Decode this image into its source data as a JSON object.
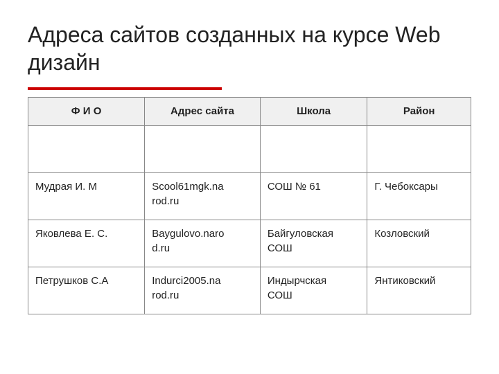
{
  "title": "Адреса сайтов созданных на курсе Web дизайн",
  "table": {
    "headers": [
      "Ф И О",
      "Адрес сайта",
      "Школа",
      "Район"
    ],
    "rows": [
      [
        "",
        "",
        "",
        ""
      ],
      [
        "Мудрая И. М",
        "Scool61mgk.na\nrod.ru",
        "СОШ № 61",
        "Г. Чебоксары"
      ],
      [
        "Яковлева Е. С.",
        "Baygulovo.naro\nd.ru",
        "Байгуловская\nСОШ",
        "Козловский"
      ],
      [
        "Петрушков С.А",
        "Indurci2005.na\nrod.ru",
        "Индырчская\nСОШ",
        "Янтиковский"
      ]
    ]
  }
}
